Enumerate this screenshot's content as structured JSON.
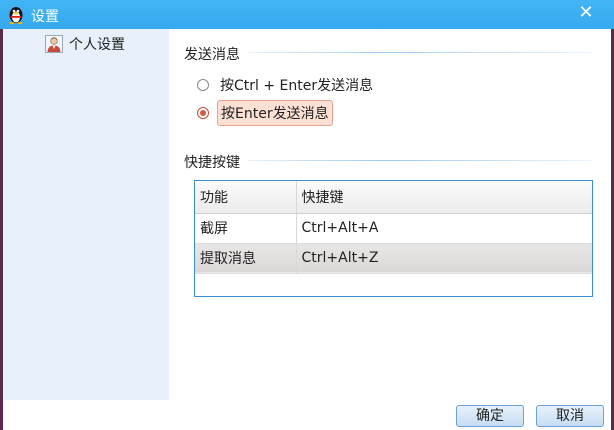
{
  "window": {
    "title": "设置",
    "icon": "qq-penguin-icon",
    "close_glyph": "✕"
  },
  "sidebar": {
    "items": [
      {
        "label": "个人设置",
        "icon": "person-icon"
      }
    ]
  },
  "send_section": {
    "title": "发送消息",
    "options": [
      {
        "label": "按Ctrl + Enter发送消息",
        "checked": false
      },
      {
        "label": "按Enter发送消息",
        "checked": true
      }
    ]
  },
  "shortcut_section": {
    "title": "快捷按键",
    "columns": [
      "功能",
      "快捷键"
    ],
    "rows": [
      {
        "function": "截屏",
        "key": "Ctrl+Alt+A",
        "selected": false
      },
      {
        "function": "提取消息",
        "key": "Ctrl+Alt+Z",
        "selected": true
      }
    ]
  },
  "footer": {
    "ok_label": "确定",
    "cancel_label": "取消"
  },
  "colors": {
    "titlebar": "#3aaef3",
    "sidebar_bg": "#e7f0fb",
    "accent_border": "#3b8fd0",
    "radio_checked": "#d9583f"
  }
}
